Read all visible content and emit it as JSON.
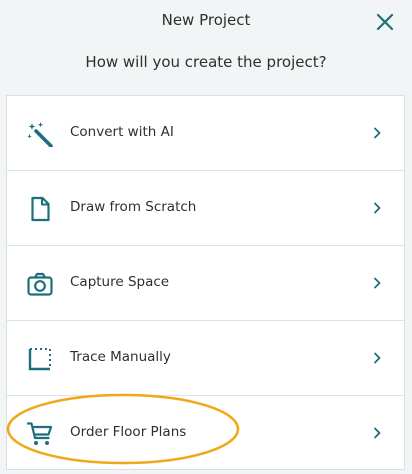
{
  "dialog": {
    "title": "New Project",
    "subtitle": "How will you create the project?"
  },
  "options": [
    {
      "label": "Convert with AI",
      "icon": "magic-wand-icon"
    },
    {
      "label": "Draw from Scratch",
      "icon": "document-icon"
    },
    {
      "label": "Capture Space",
      "icon": "camera-icon"
    },
    {
      "label": "Trace Manually",
      "icon": "trace-square-icon"
    },
    {
      "label": "Order Floor Plans",
      "icon": "cart-icon"
    }
  ],
  "colors": {
    "accent": "#1f6e7c",
    "highlight": "#f0a818",
    "background": "#f2f5f6"
  }
}
